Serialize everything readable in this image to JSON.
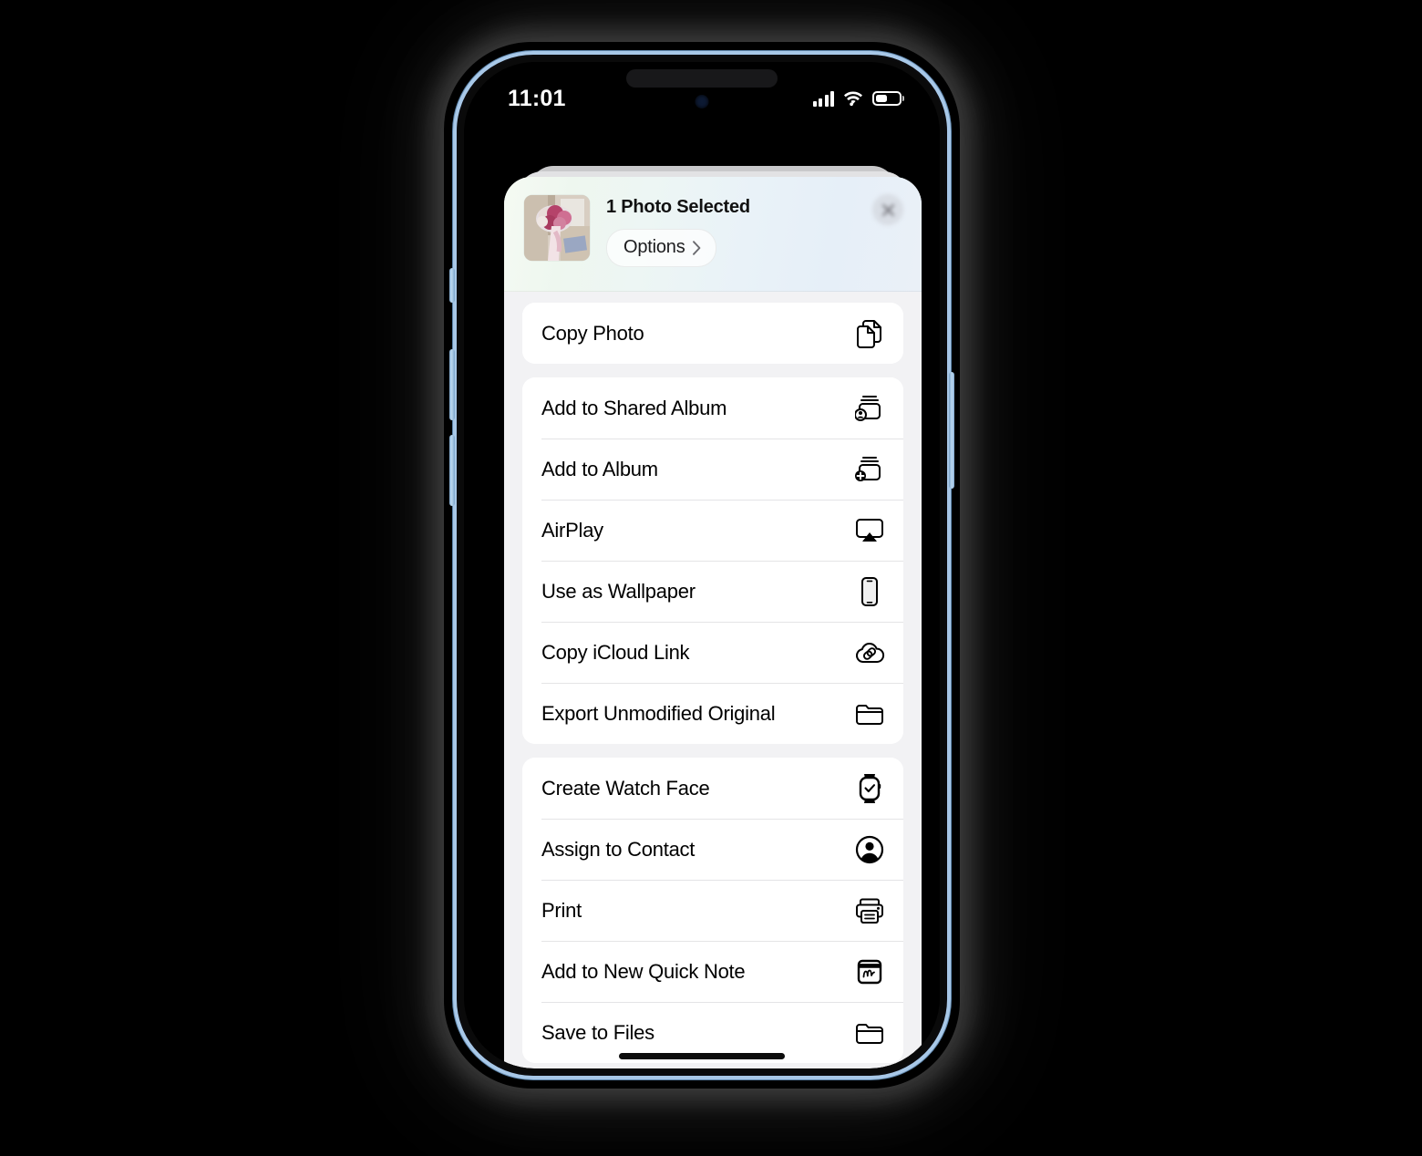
{
  "device": {
    "frame_color": "#a8c8e8",
    "buttons": [
      "silence-switch",
      "volume-up",
      "volume-down",
      "power"
    ]
  },
  "status_bar": {
    "time": "11:01",
    "signal_icon": "cellular-signal-icon",
    "signal_bars": 4,
    "wifi_icon": "wifi-icon",
    "battery_icon": "battery-icon",
    "battery_percent": 52
  },
  "share_sheet": {
    "header": {
      "title": "1 Photo Selected",
      "options_label": "Options",
      "options_chevron_icon": "chevron-right-icon",
      "close_icon": "close-icon",
      "thumbnail_icon": "photo-thumbnail-bouquet",
      "gradient_from": "#f5faf3",
      "gradient_to": "#e6eff8"
    },
    "sections": [
      {
        "items": [
          {
            "label": "Copy Photo",
            "icon": "copy-documents-icon"
          }
        ]
      },
      {
        "items": [
          {
            "label": "Add to Shared Album",
            "icon": "shared-album-icon"
          },
          {
            "label": "Add to Album",
            "icon": "add-to-album-icon"
          },
          {
            "label": "AirPlay",
            "icon": "airplay-icon"
          },
          {
            "label": "Use as Wallpaper",
            "icon": "iphone-icon"
          },
          {
            "label": "Copy iCloud Link",
            "icon": "icloud-link-icon"
          },
          {
            "label": "Export Unmodified Original",
            "icon": "folder-icon"
          }
        ]
      },
      {
        "items": [
          {
            "label": "Create Watch Face",
            "icon": "apple-watch-icon"
          },
          {
            "label": "Assign to Contact",
            "icon": "contact-person-icon"
          },
          {
            "label": "Print",
            "icon": "printer-icon"
          },
          {
            "label": "Add to New Quick Note",
            "icon": "quick-note-icon"
          },
          {
            "label": "Save to Files",
            "icon": "folder-icon"
          }
        ]
      }
    ]
  },
  "home_indicator": "home-indicator"
}
